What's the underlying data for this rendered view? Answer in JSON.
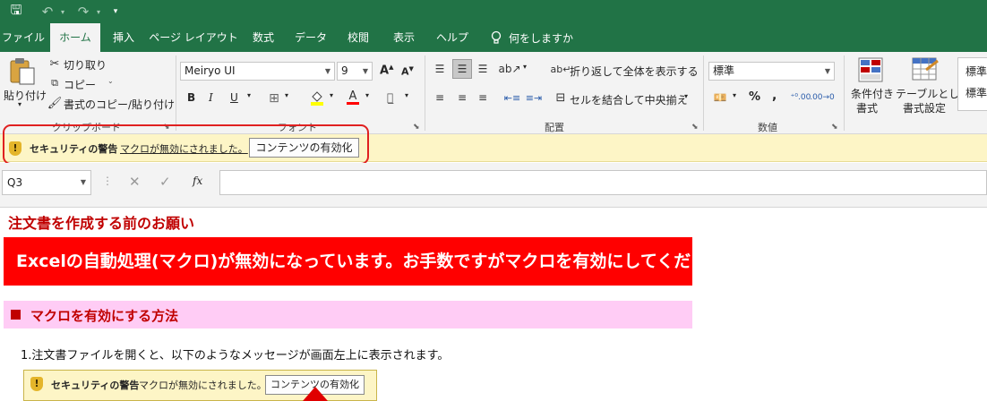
{
  "titlebar": {
    "save": "🖫",
    "undo": "↶",
    "redo": "↷",
    "more": "▾"
  },
  "tabs": [
    "ファイル",
    "ホーム",
    "挿入",
    "ページ レイアウト",
    "数式",
    "データ",
    "校閲",
    "表示",
    "ヘルプ"
  ],
  "tell_me": "何をしますか",
  "clipboard": {
    "paste": "貼り付け",
    "cut": "切り取り",
    "copy": "コピー",
    "format_painter": "書式のコピー/貼り付け",
    "label": "クリップボード"
  },
  "font": {
    "name": "Meiryo UI",
    "size": "9",
    "bold": "B",
    "italic": "I",
    "underline": "U",
    "grow": "A",
    "shrink": "A",
    "font_color": "A",
    "label": "フォント"
  },
  "alignment": {
    "wrap": "折り返して全体を表示する",
    "merge": "セルを結合して中央揃え",
    "label": "配置"
  },
  "number": {
    "format": "標準",
    "percent": "%",
    "comma": ",",
    "label": "数値"
  },
  "styles": {
    "conditional_line1": "条件付き",
    "conditional_line2": "書式",
    "table_line1": "テーブルとして",
    "table_line2": "書式設定",
    "cell_style1": "標準",
    "cell_style2": "標準"
  },
  "security": {
    "title": "セキュリティの警告",
    "message": "マクロが無効にされました。",
    "button": "コンテンツの有効化"
  },
  "formula": {
    "namebox": "Q3",
    "fx": "fx"
  },
  "sheet": {
    "heading": "注文書を作成する前のお願い",
    "banner": "Excelの自動処理(マクロ)が無効になっています。お手数ですがマクロを有効にしてください。",
    "section": "マクロを有効にする方法",
    "step1": "1.注文書ファイルを開くと、以下のようなメッセージが画面左上に表示されます。",
    "sample_title": "セキュリティの警告",
    "sample_message": "マクロが無効にされました。",
    "sample_button": "コンテンツの有効化"
  },
  "colors": {
    "excel_green": "#217346",
    "alert_red": "#ff0000",
    "warning_yellow": "#fdf5c6",
    "pink": "#ffccf5"
  }
}
